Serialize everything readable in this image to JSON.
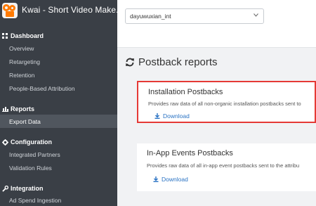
{
  "app": {
    "title": "Kwai - Short Video Make..."
  },
  "sidebar": {
    "sections": [
      {
        "title": "Dashboard",
        "icon": "grid-icon",
        "items": [
          {
            "label": "Overview"
          },
          {
            "label": "Retargeting"
          },
          {
            "label": "Retention"
          },
          {
            "label": "People-Based Attribution"
          }
        ]
      },
      {
        "title": "Reports",
        "icon": "bar-chart-icon",
        "items": [
          {
            "label": "Export Data",
            "active": true
          }
        ]
      },
      {
        "title": "Configuration",
        "icon": "gear-icon",
        "items": [
          {
            "label": "Integrated Partners"
          },
          {
            "label": "Validation Rules"
          }
        ]
      },
      {
        "title": "Integration",
        "icon": "wrench-icon",
        "items": [
          {
            "label": "Ad Spend Ingestion"
          }
        ]
      }
    ]
  },
  "main": {
    "account_select": {
      "value": "dayuwuxian_int"
    },
    "page_title": "Postback reports",
    "cards": [
      {
        "title": "Installation Postbacks",
        "desc": "Provides raw data of all non-organic installation postbacks sent to",
        "link": "Download",
        "highlighted": true
      },
      {
        "title": "In-App Events Postbacks",
        "desc": "Provides raw data of all in-app event postbacks sent to the attribu",
        "link": "Download",
        "highlighted": false
      }
    ]
  },
  "colors": {
    "sidebar_bg": "#3a3f46",
    "active_bg": "#50565e",
    "link": "#2a73c4",
    "highlight": "#e53935"
  }
}
